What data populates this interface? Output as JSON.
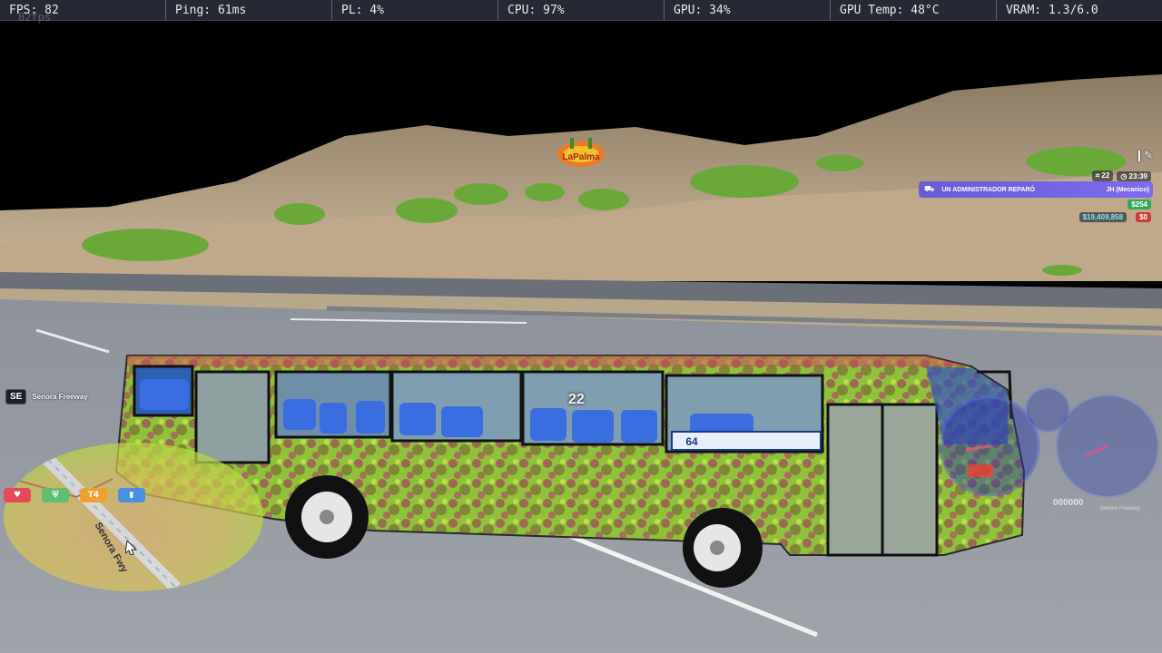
{
  "perf": {
    "fps": "FPS: 82",
    "ping": "Ping: 61ms",
    "pl": "PL: 4%",
    "cpu": "CPU: 97%",
    "gpu": "GPU: 34%",
    "gpu_temp": "GPU Temp: 48°C",
    "vram": "VRAM: 1.3/6.0"
  },
  "fps_ghost": "82fps",
  "billboard": "LaPalma",
  "bus": {
    "number": "22",
    "route_sign": "64"
  },
  "location": {
    "direction": "SE",
    "street": "Senora Freeway"
  },
  "minimap": {
    "road_label": "Senora Fwy"
  },
  "hud": {
    "players": "22",
    "time": "23:39",
    "notification": "UN ADMINISTRADOR REPARÓ",
    "job": "JH (Mecanico)",
    "cash": "$254",
    "bank": "$19,409,858",
    "dirty": "$0"
  },
  "speedo": {
    "odometer": "000000",
    "sub": "Senora Freeway"
  },
  "colors": {
    "perf_bg": "#242933",
    "notify": "#7d6cf0",
    "bus_body": "#8fd63a",
    "sky": "#000000"
  }
}
